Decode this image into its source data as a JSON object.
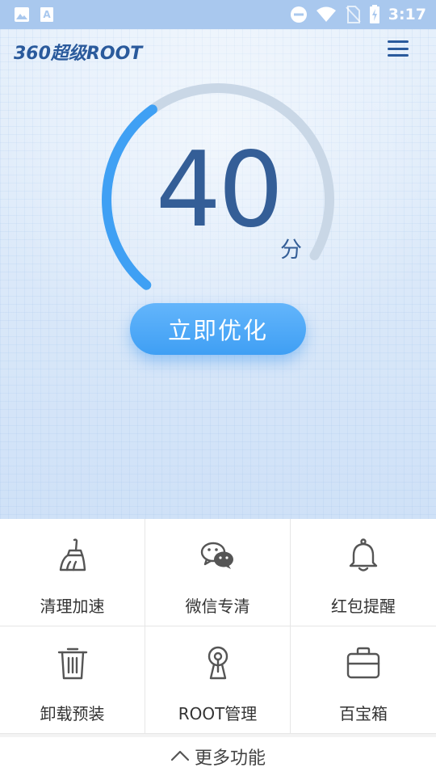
{
  "status_bar": {
    "time": "3:17",
    "left_icons": [
      "image-icon",
      "text-a-icon"
    ],
    "right_icons": [
      "do-not-disturb-icon",
      "wifi-icon",
      "no-sim-icon",
      "battery-charging-icon"
    ]
  },
  "header": {
    "logo_text": "360超级ROOT",
    "menu_icon": "hamburger-menu-icon"
  },
  "score": {
    "value": "40",
    "unit": "分",
    "gauge_fraction": 0.4,
    "gauge_color": "#3fa0f4",
    "track_color": "#c9d7e6"
  },
  "optimize_button": {
    "label": "立即优化"
  },
  "tools": [
    {
      "label": "清理加速",
      "icon": "broom-icon"
    },
    {
      "label": "微信专清",
      "icon": "wechat-icon"
    },
    {
      "label": "红包提醒",
      "icon": "bell-icon"
    },
    {
      "label": "卸载预装",
      "icon": "trash-icon"
    },
    {
      "label": "ROOT管理",
      "icon": "keyhole-icon"
    },
    {
      "label": "百宝箱",
      "icon": "toolbox-icon"
    }
  ],
  "more": {
    "label": "更多功能",
    "icon": "chevron-up-icon"
  },
  "colors": {
    "accent": "#3fa0f4",
    "brand": "#2a5a9c",
    "score_text": "#345e97"
  }
}
